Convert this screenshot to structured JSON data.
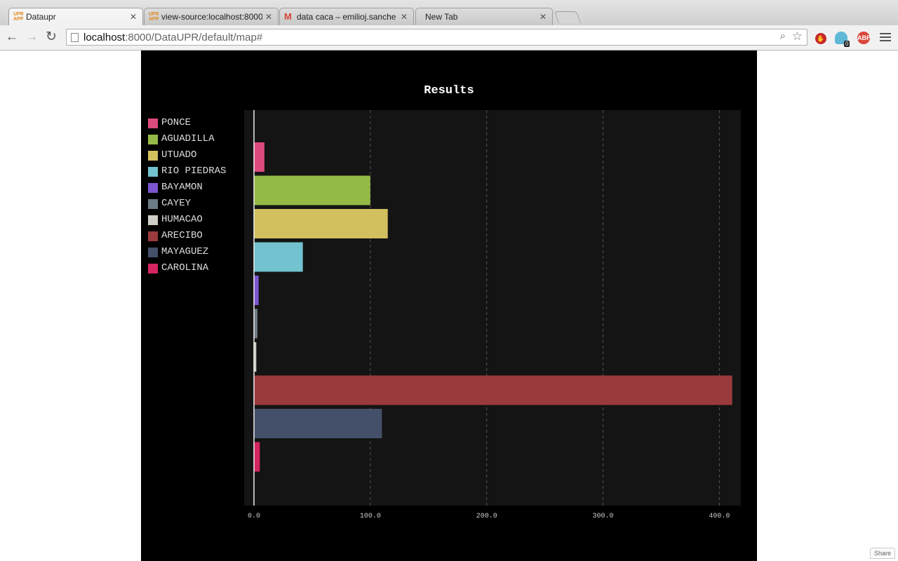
{
  "browser": {
    "tabs": [
      {
        "title": "Dataupr",
        "favicon": "upr-favicon",
        "active": true
      },
      {
        "title": "view-source:localhost:8000",
        "favicon": "upr-favicon",
        "active": false
      },
      {
        "title": "data caca – emilioj.sanche",
        "favicon": "gmail-icon",
        "active": false
      },
      {
        "title": "New Tab",
        "favicon": "",
        "active": false
      }
    ],
    "url_host": "localhost",
    "url_path": ":8000/DataUPR/default/map#",
    "extensions": {
      "stop_badge": "",
      "ghostery_count": "0",
      "adblock_label": "ABP"
    }
  },
  "page": {
    "share_label": "Share"
  },
  "chart_data": {
    "type": "bar",
    "orientation": "horizontal",
    "title": "Results",
    "categories": [
      "PONCE",
      "AGUADILLA",
      "UTUADO",
      "RIO PIEDRAS",
      "BAYAMON",
      "CAYEY",
      "HUMACAO",
      "ARECIBO",
      "MAYAGUEZ",
      "CAROLINA"
    ],
    "values": [
      9,
      100,
      115,
      42,
      4,
      3,
      2,
      411,
      110,
      5
    ],
    "colors": [
      "#dd4a7e",
      "#95b946",
      "#d1c05d",
      "#72c2d0",
      "#7c55d1",
      "#6b7b84",
      "#cfcfc7",
      "#9b3a3d",
      "#445069",
      "#d52560"
    ],
    "x_ticks": [
      "0.0",
      "100.0",
      "200.0",
      "300.0",
      "400.0"
    ],
    "xlim": [
      0,
      420
    ],
    "grid": true,
    "legend_position": "left"
  }
}
